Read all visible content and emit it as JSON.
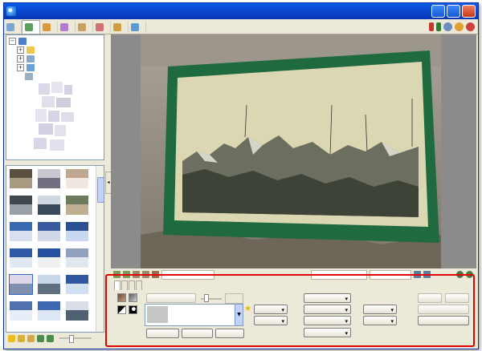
{
  "window": {
    "title": "",
    "controls": {
      "minimize": "",
      "maximize": "",
      "close": ""
    }
  },
  "tabs": [
    {
      "label": "",
      "color": "#7aa6d6"
    },
    {
      "label": "",
      "color": "#5aa05a",
      "active": true
    },
    {
      "label": "",
      "color": "#d89a3a"
    },
    {
      "label": "",
      "color": "#b47ad0"
    },
    {
      "label": "",
      "color": "#c8a060"
    },
    {
      "label": "",
      "color": "#d07070"
    },
    {
      "label": "",
      "color": "#d0a040"
    },
    {
      "label": "",
      "color": "#5b9bd5"
    }
  ],
  "tab_right": {
    "menu_badge": "",
    "exit_badge": ""
  },
  "tree": {
    "items": [
      {
        "label": ""
      },
      {
        "label": ""
      },
      {
        "label": ""
      },
      {
        "label": ""
      },
      {
        "label": ""
      }
    ]
  },
  "thumbnails": {
    "labels": [
      "",
      "",
      "",
      "",
      "",
      "",
      "",
      "",
      "",
      "",
      "",
      "",
      "",
      "",
      "",
      "",
      "",
      "",
      "",
      "",
      ""
    ]
  },
  "photo": {
    "watermark": "",
    "sign_labels": [
      "",
      "",
      "",
      ""
    ]
  },
  "statusbar": {
    "photo_size": "",
    "filename": "",
    "filesize": "",
    "zoom": ""
  },
  "editor": {
    "tabs": [
      "",
      "",
      "",
      ""
    ],
    "merge_frame": "",
    "opacity": "",
    "frame_name": "",
    "round_corners": "",
    "expand_canvas": "",
    "photo_frame_line": "",
    "resize": "",
    "brightness_color": "",
    "auto_level": "",
    "auto_contrast": "",
    "sharpen": "",
    "filter": "",
    "soften": "",
    "backlight": "",
    "undo": "",
    "redo": "",
    "undo_all": "",
    "save": ""
  }
}
